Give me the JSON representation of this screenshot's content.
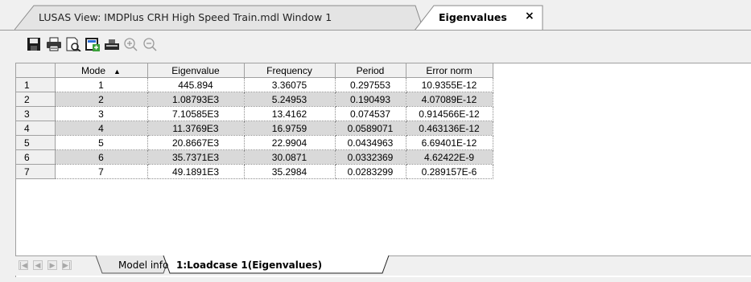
{
  "tabs": {
    "view_title": "LUSAS View: IMDPlus CRH High Speed Train.mdl Window 1",
    "active_title": "Eigenvalues",
    "close_glyph": "×"
  },
  "toolbar": {
    "icons": [
      "save-icon",
      "print-icon",
      "print-preview-icon",
      "export-icon",
      "copy-icon",
      "zoom-in-icon",
      "zoom-out-icon"
    ]
  },
  "grid": {
    "columns": [
      "Mode",
      "Eigenvalue",
      "Frequency",
      "Period",
      "Error norm"
    ],
    "sort_glyph": "▲",
    "rows": [
      {
        "num": "1",
        "mode": "1",
        "eigenvalue": "445.894",
        "frequency": "3.36075",
        "period": "0.297553",
        "error_norm": "10.9355E-12"
      },
      {
        "num": "2",
        "mode": "2",
        "eigenvalue": "1.08793E3",
        "frequency": "5.24953",
        "period": "0.190493",
        "error_norm": "4.07089E-12"
      },
      {
        "num": "3",
        "mode": "3",
        "eigenvalue": "7.10585E3",
        "frequency": "13.4162",
        "period": "0.074537",
        "error_norm": "0.914566E-12"
      },
      {
        "num": "4",
        "mode": "4",
        "eigenvalue": "11.3769E3",
        "frequency": "16.9759",
        "period": "0.0589071",
        "error_norm": "0.463136E-12"
      },
      {
        "num": "5",
        "mode": "5",
        "eigenvalue": "20.8667E3",
        "frequency": "22.9904",
        "period": "0.0434963",
        "error_norm": "6.69401E-12"
      },
      {
        "num": "6",
        "mode": "6",
        "eigenvalue": "35.7371E3",
        "frequency": "30.0871",
        "period": "0.0332369",
        "error_norm": "4.62422E-9"
      },
      {
        "num": "7",
        "mode": "7",
        "eigenvalue": "49.1891E3",
        "frequency": "35.2984",
        "period": "0.0283299",
        "error_norm": "0.289157E-6"
      }
    ]
  },
  "sheets": {
    "nav": [
      "|◀",
      "◀",
      "▶",
      "▶|"
    ],
    "items": [
      "Model info",
      "1:Loadcase 1(Eigenvalues)"
    ],
    "active_index": 1
  },
  "colors": {
    "alt_row": "#d9d9d9",
    "header_bg": "#f0f0f0"
  }
}
